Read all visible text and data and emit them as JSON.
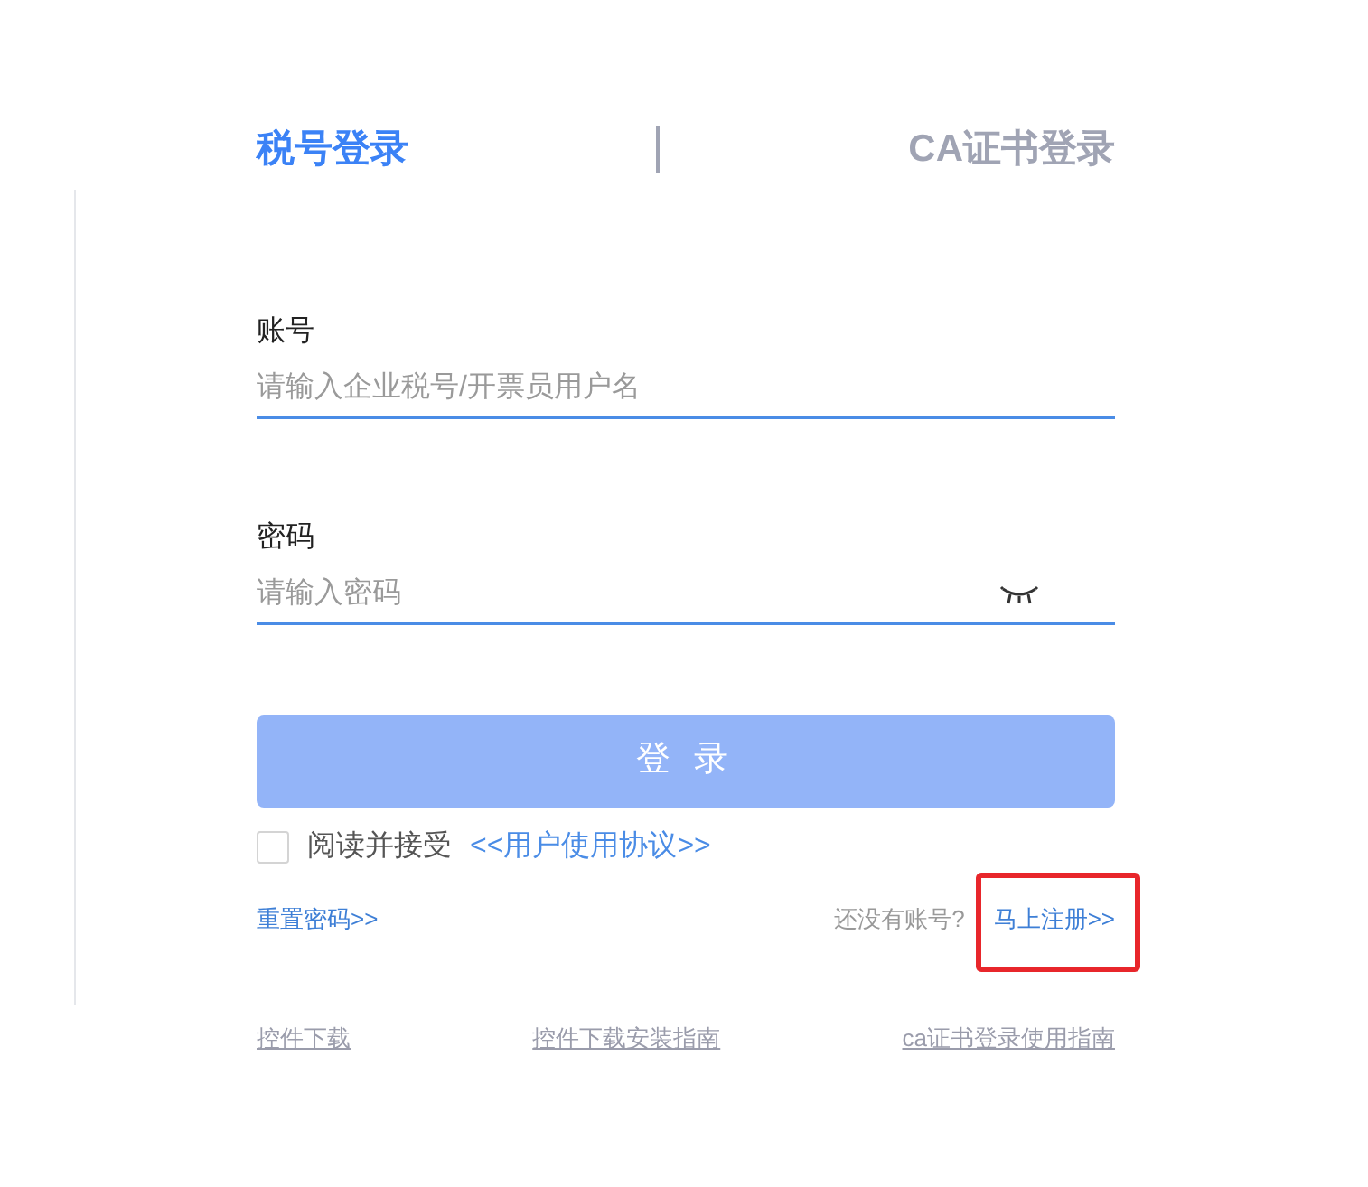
{
  "tabs": [
    {
      "label": "税号登录",
      "selected": true
    },
    {
      "label": "CA证书登录",
      "selected": false
    }
  ],
  "account": {
    "label": "账号",
    "placeholder": "请输入企业税号/开票员用户名"
  },
  "password": {
    "label": "密码",
    "placeholder": "请输入密码",
    "visible": false
  },
  "login_button": {
    "label": "登 录",
    "disabled": true
  },
  "agreement": {
    "checked": false,
    "text": "阅读并接受",
    "link": "<<用户使用协议>>"
  },
  "reset_link": "重置密码>>",
  "register": {
    "prompt": "还没有账号?",
    "link": "马上注册>>",
    "highlighted": true
  },
  "footer_links": [
    "控件下载",
    "控件下载安装指南",
    "ca证书登录使用指南"
  ]
}
